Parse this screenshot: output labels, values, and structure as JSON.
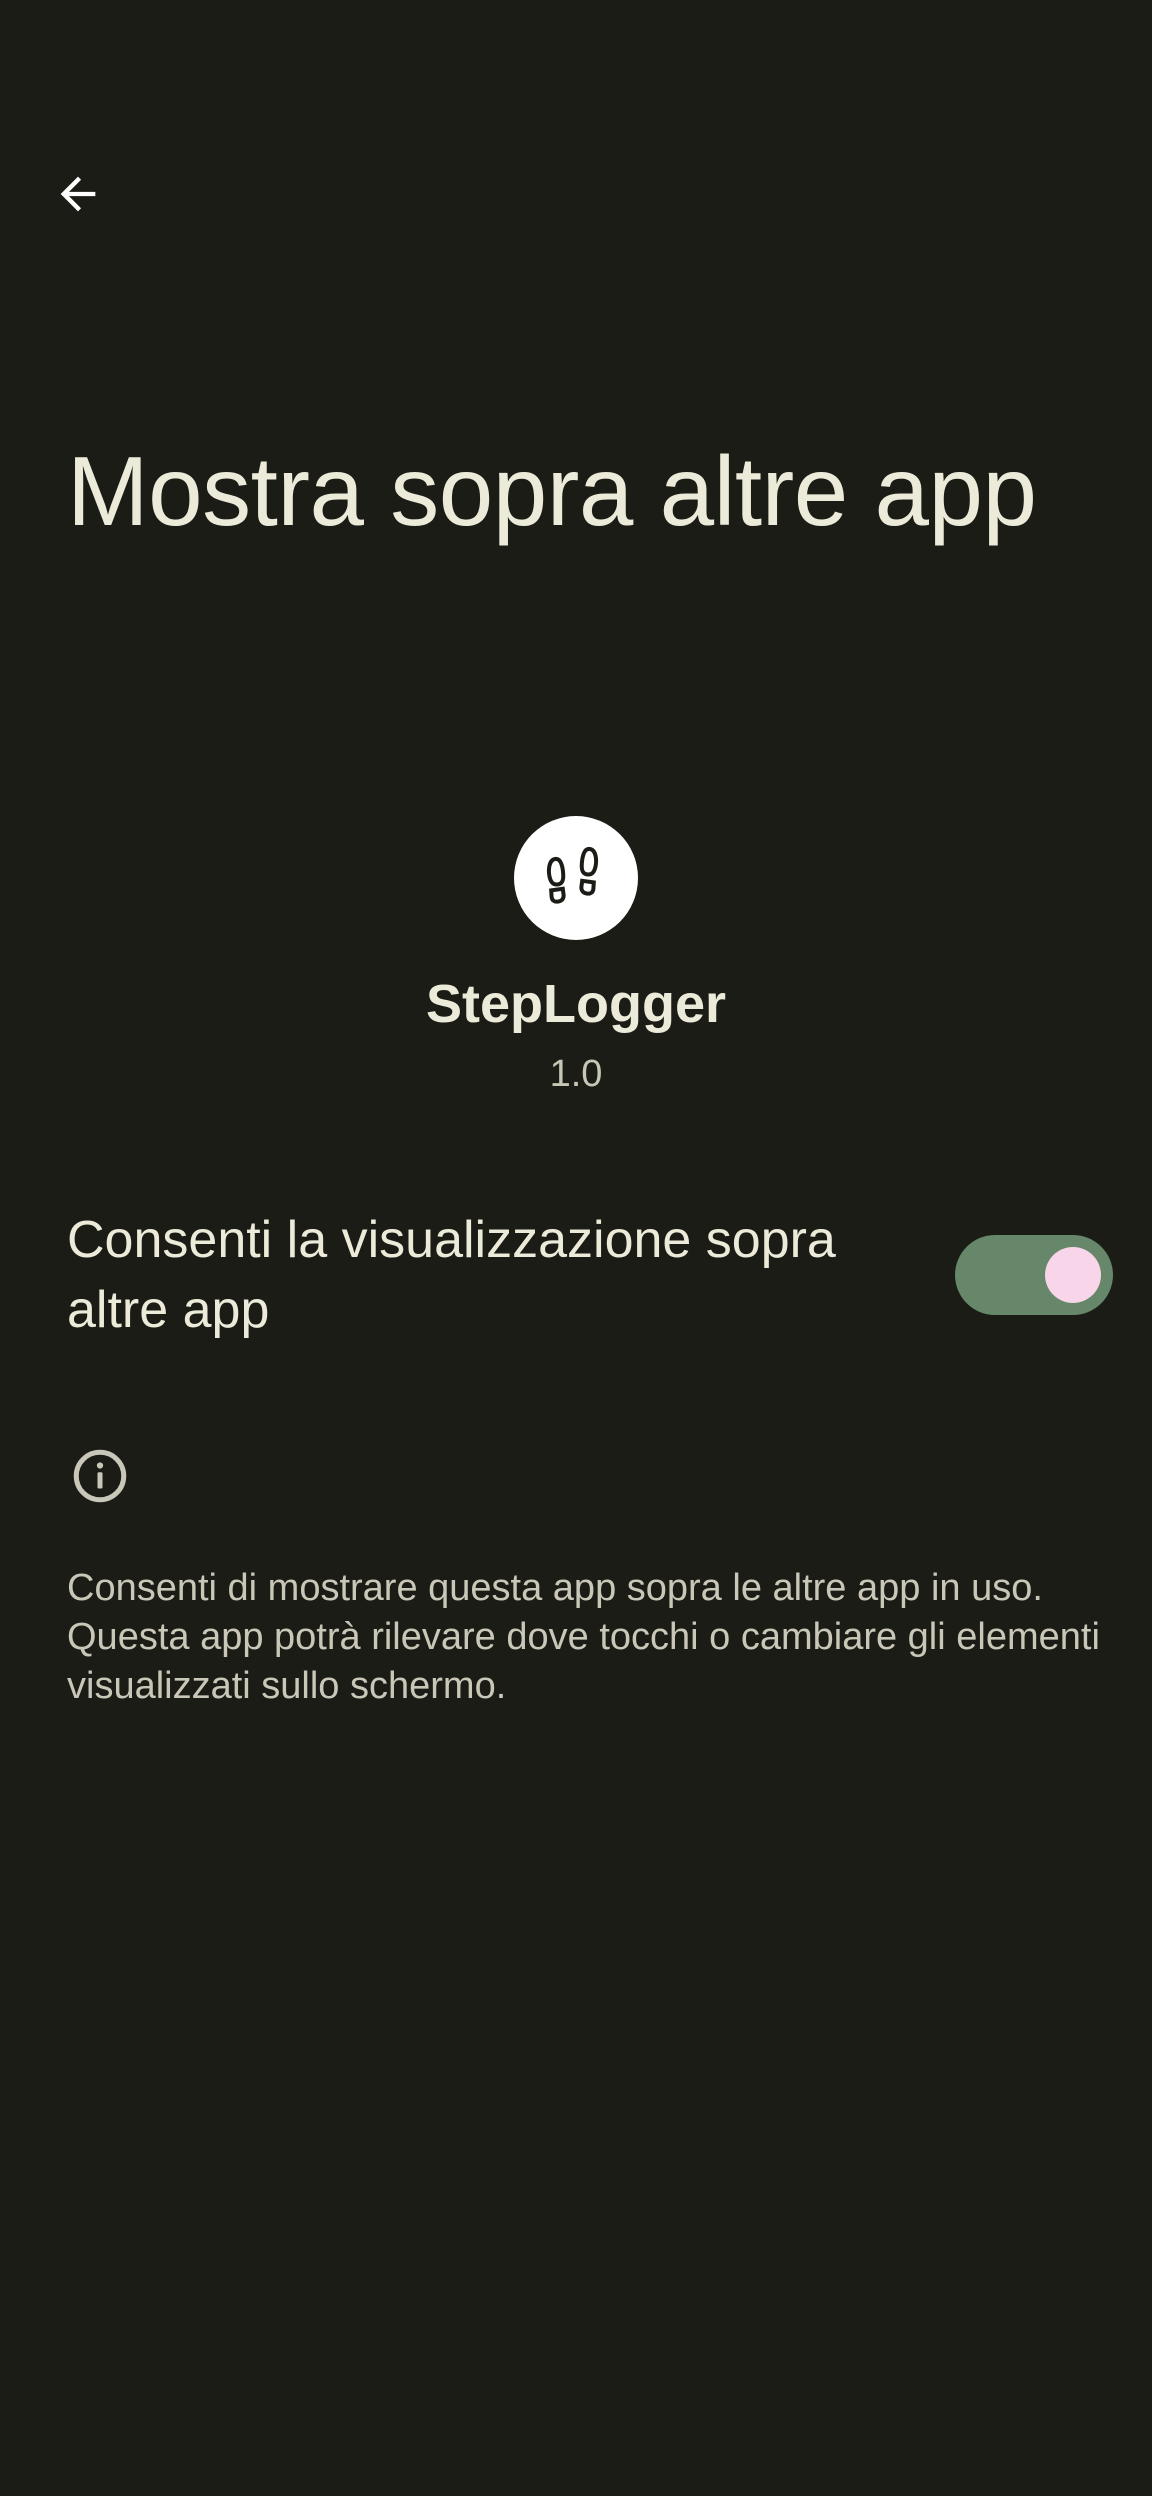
{
  "header": {
    "back_icon": "arrow-back-icon",
    "title": "Mostra sopra altre app"
  },
  "app": {
    "icon": "footprints-icon",
    "name": "StepLogger",
    "version": "1.0"
  },
  "setting": {
    "label": "Consenti la visualizzazione sopra altre app",
    "enabled": true
  },
  "info": {
    "icon": "info-icon",
    "text": "Consenti di mostrare questa app sopra le altre app in uso. Questa app potrà rilevare dove tocchi o cambiare gli elementi visualizzati sullo schermo."
  },
  "colors": {
    "background": "#1c1c16",
    "switch_track_on": "#66876a",
    "switch_thumb_on": "#f8d5e8",
    "text_primary": "#ecead9",
    "text_secondary": "#c9c7b7"
  }
}
